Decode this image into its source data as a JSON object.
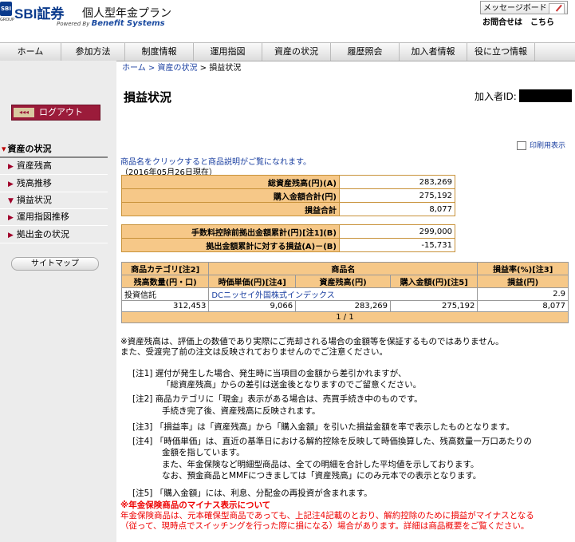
{
  "header": {
    "logo_mark": "SBI",
    "logo_group": "GROUP",
    "brand": "SBI証券",
    "plan": "個人型年金プラン",
    "powered_prefix": "Powered By",
    "powered_name": "Benefit Systems",
    "message_board": "メッセージボード",
    "contact": "お問合せは　こちら"
  },
  "nav": [
    {
      "label": "ホーム",
      "w": 77
    },
    {
      "label": "参加方法",
      "w": 80
    },
    {
      "label": "制度情報",
      "w": 86
    },
    {
      "label": "運用指図",
      "w": 86
    },
    {
      "label": "資産の状況",
      "w": 86
    },
    {
      "label": "履歴照会",
      "w": 86
    },
    {
      "label": "加入者情報",
      "w": 85
    },
    {
      "label": "役に立つ情報",
      "w": 85
    }
  ],
  "breadcrumb": {
    "home": "ホーム",
    "sep1": " > ",
    "assets": "資産の状況",
    "sep2": " > ",
    "current": "損益状況"
  },
  "sidebar": {
    "logout_arrows": "◂◂◂",
    "logout": "ログアウト",
    "section": "資産の状況",
    "items": [
      "資産残高",
      "残高推移",
      "損益状況",
      "運用指図推移",
      "拠出金の状況"
    ],
    "sitemap": "サイトマップ"
  },
  "page": {
    "title": "損益状況",
    "member_label": "加入者ID:",
    "print": "印刷用表示",
    "hint": "商品名をクリックすると商品説明がご覧になれます。",
    "date": "（2016年05月26日現在）"
  },
  "summary1": [
    {
      "label": "総資産残高(円)(A)",
      "value": "283,269"
    },
    {
      "label": "購入金額合計(円)",
      "value": "275,192"
    },
    {
      "label": "損益合計",
      "value": "8,077"
    }
  ],
  "summary2": [
    {
      "label": "手数料控除前拠出金額累計(円)[注1](B)",
      "value": "299,000"
    },
    {
      "label": "拠出金額累計に対する損益(A)－(B)",
      "value": "-15,731"
    }
  ],
  "detail": {
    "h1": {
      "category": "商品カテゴリ[注2]",
      "name": "商品名",
      "rate": "損益率(%)[注3]"
    },
    "h2": {
      "qty": "残高数量(円・口)",
      "price": "時価単価(円)[注4]",
      "balance": "資産残高(円)",
      "cost": "購入金額(円)[注5]",
      "pl": "損益(円)"
    },
    "row1": {
      "category": "投資信託",
      "name": "DCニッセイ外国株式インデックス",
      "rate": "2.9"
    },
    "row2": {
      "qty": "312,453",
      "price": "9,066",
      "balance": "283,269",
      "cost": "275,192",
      "pl": "8,077"
    },
    "pager": "1 / 1"
  },
  "notes": {
    "p1": "※資産残高は、評価上の数値であり実際にご売却される場合の金額等を保証するものではありません。",
    "p2": "また、受渡完了前の注文は反映されておりませんのでご注意ください。",
    "n1a": "[注1]  遅付が発生した場合、発生時に当項目の金額から差引かれますが、",
    "n1b": "「総資産残高」からの差引は送金後となりますのでご留意ください。",
    "n2a": "[注2]  商品カテゴリに「現金」表示がある場合は、売買手続き中のものです。",
    "n2b": "手続き完了後、資産残高に反映されます。",
    "n3": "[注3]  「損益率」は「資産残高」から「購入金額」を引いた損益金額を率で表示したものとなります。",
    "n4a": "[注4]  「時価単価」は、直近の基準日における解約控除を反映して時価換算した、残高数量一万口あたりの",
    "n4b": "金額を指しています。",
    "n4c": "また、年金保険など明細型商品は、全ての明細を合計した平均値を示しております。",
    "n4d": "なお、預金商品とMMFにつきましては「資産残高」にのみ元本での表示となります。",
    "n5": "[注5]  「購入金額」には、利息、分配金の再投資が含まれます。",
    "warn_title": "※年金保険商品のマイナス表示について",
    "warn1": "年金保険商品は、元本確保型商品であっても、上記注4記載のとおり、解約控除のために損益がマイナスとなる",
    "warn2": "（従って、現時点でスイッチングを行った際に損になる）場合があります。詳細は商品概要をご覧ください。"
  }
}
